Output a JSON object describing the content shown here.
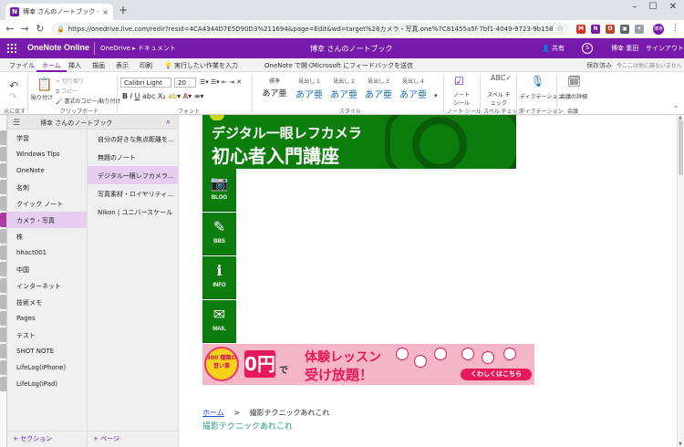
{
  "browser": {
    "tab_title": "博幸 さんのノートブック - Microsoft O",
    "tab_close": "×",
    "new_tab": "+",
    "url": "https://onedrive.live.com/redir?resid=4CA4344D7E5D90D3%211694&page=Edit&wd=target%28カメラ・写真.one%7C81455a5f-7bf1-4049-9723-9b158cb64075%2Fデジタル...",
    "ext_gmail_count": "20",
    "profile_initials": "博幸"
  },
  "app": {
    "name": "OneNote Online",
    "breadcrumb": "OneDrive ▸ ドキュメント",
    "notebook_title": "博幸 さんのノートブック",
    "share_label": "共有",
    "user_name": "博幸 重田",
    "signout": "サインアウト",
    "accent": "#7719aa"
  },
  "ribbon_tabs": {
    "file": "ファイル",
    "home": "ホーム",
    "insert": "挿入",
    "draw": "描画",
    "view": "表示",
    "print": "印刷",
    "tellme": "実行したい作業を入力",
    "open_desktop": "OneNote で開く",
    "feedback": "Microsoft にフィードバックを送信",
    "saved": "保存済み",
    "hint": "今ここは他に誰もいません"
  },
  "ribbon": {
    "undo_group": "元に戻す",
    "paste": "貼り付け",
    "cut": "切り取り",
    "copy": "コピー",
    "format_painter": "書式のコピー/貼り付け",
    "clipboard_group": "クリップボード",
    "font_name": "Calibri Light",
    "font_size": "20",
    "font_group": "フォント",
    "styles": [
      {
        "label": "標準",
        "sample": "あア亜"
      },
      {
        "label": "見出し 1",
        "sample": "あア亜"
      },
      {
        "label": "見出し 2",
        "sample": "あア亜"
      },
      {
        "label": "見出し 3",
        "sample": "あア亜"
      },
      {
        "label": "見出し 4",
        "sample": "あア亜"
      }
    ],
    "style_group": "スタイル",
    "note_tag": "ノート シール",
    "note_tag_group": "ノート シール",
    "spell": "スペル チェック",
    "spell_group": "スペル チェック",
    "dictation": "ディクテーション",
    "dictation_group": "ディクテーション",
    "meeting": "会議の詳細",
    "meeting_group": "会議"
  },
  "sections_pane": {
    "title": "博幸 さんのノートブック",
    "items": [
      "学習",
      "Windows Tips",
      "OneNote",
      "名刺",
      "クイック ノート",
      "カメラ・写真",
      "株",
      "hhact001",
      "中国",
      "インターネット",
      "技術メモ",
      "Pages",
      "テスト",
      "SHOT NOTE",
      "LifeLog(iPhone)",
      "LifeLog(iPad)"
    ],
    "add_section": "+ セクション"
  },
  "pages_pane": {
    "items": [
      "自分の好きな焦点距離を...",
      "無題のノート",
      "デジタル一眼レフカメラ...",
      "写真素材・ロイヤリティ...",
      "Nikon | ユニバースケール"
    ],
    "add_page": "+ ページ"
  },
  "content": {
    "banner_line1": "デジタル一眼レフカメラ",
    "banner_line2": "初心者入門講座",
    "side_buttons": [
      "BLOG",
      "BBS",
      "INFO",
      "MAIL"
    ],
    "promo_badge": "300 種類の 習い事",
    "promo_zero": "0円",
    "promo_de": "で",
    "promo_line1": "体験レッスン",
    "promo_line2": "受け放題！",
    "promo_cta": "くわしくはこちら",
    "breadcrumb_home": "ホーム",
    "breadcrumb_arrow": ">",
    "breadcrumb_current": "撮影テクニックあれこれ",
    "article_title": "撮影テクニックあれこれ"
  }
}
